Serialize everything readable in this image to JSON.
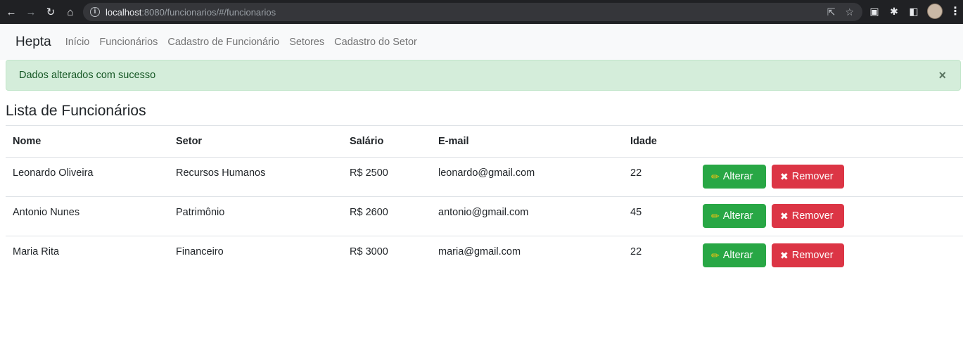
{
  "browser": {
    "url_host": "localhost",
    "url_rest": ":8080/funcionarios/#/funcionarios",
    "icons": [
      "back-icon",
      "forward-icon",
      "reload-icon",
      "home-icon",
      "info-icon",
      "share-icon",
      "star-icon",
      "extension-icon",
      "puzzle-icon",
      "sidebar-icon",
      "profile-avatar",
      "menu-icon"
    ]
  },
  "navbar": {
    "brand": "Hepta",
    "links": [
      "Início",
      "Funcionários",
      "Cadastro de Funcionário",
      "Setores",
      "Cadastro do Setor"
    ]
  },
  "alert": {
    "message": "Dados alterados com sucesso",
    "close": "×"
  },
  "page": {
    "title": "Lista de Funcionários"
  },
  "table": {
    "headers": [
      "Nome",
      "Setor",
      "Salário",
      "E-mail",
      "Idade"
    ],
    "rows": [
      {
        "nome": "Leonardo Oliveira",
        "setor": "Recursos Humanos",
        "salario": "R$ 2500",
        "email": "leonardo@gmail.com",
        "idade": "22"
      },
      {
        "nome": "Antonio Nunes",
        "setor": "Patrimônio",
        "salario": "R$ 2600",
        "email": "antonio@gmail.com",
        "idade": "45"
      },
      {
        "nome": "Maria Rita",
        "setor": "Financeiro",
        "salario": "R$ 3000",
        "email": "maria@gmail.com",
        "idade": "22"
      }
    ],
    "edit_label": "Alterar",
    "remove_label": "Remover"
  },
  "colors": {
    "success": "#28a745",
    "danger": "#dc3545",
    "alert_bg": "#d4edda",
    "alert_text": "#155724"
  }
}
